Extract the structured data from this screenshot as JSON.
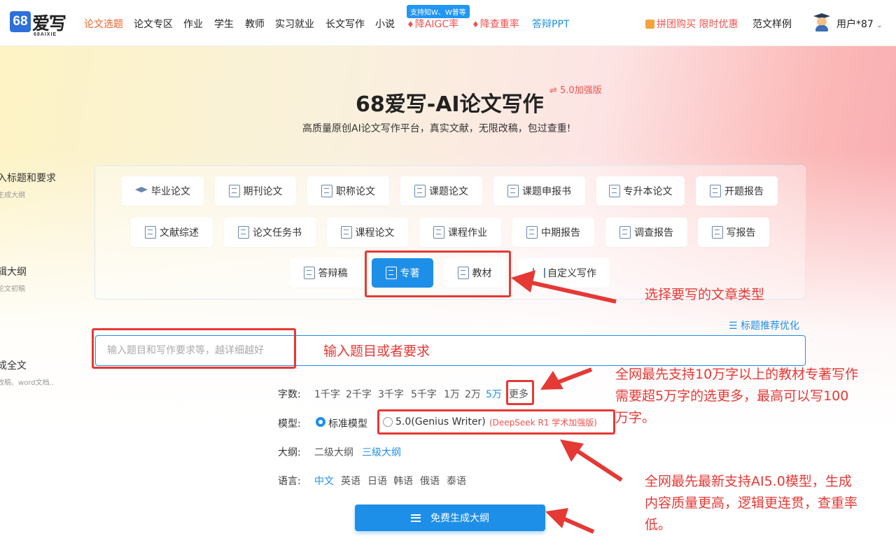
{
  "logo": {
    "mark": "68",
    "name": "爱写",
    "sub": "68AIXIE"
  },
  "nav": [
    {
      "label": "论文选题"
    },
    {
      "label": "论文专区"
    },
    {
      "label": "作业"
    },
    {
      "label": "学生"
    },
    {
      "label": "教师"
    },
    {
      "label": "实习就业"
    },
    {
      "label": "长文写作"
    },
    {
      "label": "小说"
    },
    {
      "label": "降AIGC率"
    },
    {
      "label": "降查重率"
    },
    {
      "label": "答辩PPT"
    }
  ],
  "nav_badge": "支持知W、W普等",
  "promo": "拼团购买 限时优惠",
  "samples": "范文样例",
  "user": "用户*87",
  "hero": {
    "title": "68爱写-AI论文写作",
    "version": "⇌ 5.0加强版",
    "subtitle": "高质量原创AI论文写作平台，真实文献，无限改稿，包过查重!"
  },
  "steps": [
    {
      "title": "入标题和要求",
      "desc": "生成大纲"
    },
    {
      "title": "辑大纲",
      "desc": "论文初稿"
    },
    {
      "title": "成全文",
      "desc": "改稿、word文档.."
    }
  ],
  "types": [
    {
      "label": "毕业论文",
      "icon": "graduation-cap-icon"
    },
    {
      "label": "期刊论文",
      "icon": "journal-icon"
    },
    {
      "label": "职称论文",
      "icon": "shield-icon"
    },
    {
      "label": "课题论文",
      "icon": "bookmark-icon"
    },
    {
      "label": "课题申报书",
      "icon": "document-icon"
    },
    {
      "label": "专升本论文",
      "icon": "document-check-icon"
    },
    {
      "label": "开题报告",
      "icon": "report-icon"
    },
    {
      "label": "文献综述",
      "icon": "documents-icon"
    },
    {
      "label": "论文任务书",
      "icon": "clipboard-icon"
    },
    {
      "label": "课程论文",
      "icon": "documents-icon"
    },
    {
      "label": "课程作业",
      "icon": "document-search-icon"
    },
    {
      "label": "中期报告",
      "icon": "clipboard-icon"
    },
    {
      "label": "调查报告",
      "icon": "report-icon"
    },
    {
      "label": "写报告",
      "icon": "document-search-icon"
    },
    {
      "label": "答辩稿",
      "icon": "checklist-icon"
    },
    {
      "label": "专著",
      "icon": "book-icon"
    },
    {
      "label": "教材",
      "icon": "open-book-icon"
    },
    {
      "label": "自定义写作",
      "icon": "sliders-icon"
    }
  ],
  "annotations": {
    "select_type": "选择要写的文章类型",
    "input_topic": "输入题目或者要求",
    "more_words": [
      "全网最先支持10万字以上的教材专著写作",
      "需要超5万字的选更多，最高可以写100",
      "万字。"
    ],
    "model": [
      "全网最先最新支持AI5.0模型，生成",
      "内容质量更高，逻辑更连贯，查重率",
      "低。"
    ]
  },
  "recommend": "☰ 标题推荐优化",
  "input_placeholder": "输入题目和写作要求等，越详细越好",
  "words": {
    "label": "字数:",
    "options": [
      "1千字",
      "2千字",
      "3千字",
      "5千字",
      "1万",
      "2万",
      "5万",
      "更多"
    ],
    "selected": "5万"
  },
  "model": {
    "label": "模型:",
    "options": [
      "标准模型",
      "5.0(Genius Writer)"
    ],
    "selected": "标准模型",
    "note": "(DeepSeek R1 学术加强版)"
  },
  "outline": {
    "label": "大纲:",
    "options": [
      "二级大纲",
      "三级大纲"
    ],
    "selected": "三级大纲"
  },
  "language": {
    "label": "语言:",
    "options": [
      "中文",
      "英语",
      "日语",
      "韩语",
      "俄语",
      "泰语"
    ],
    "selected": "中文"
  },
  "generate_button": "免费生成大纲",
  "colors": {
    "accent": "#1e8fe8",
    "hot": "#f0524f",
    "annotation": "#e53935",
    "active_nav": "#e8632a"
  }
}
